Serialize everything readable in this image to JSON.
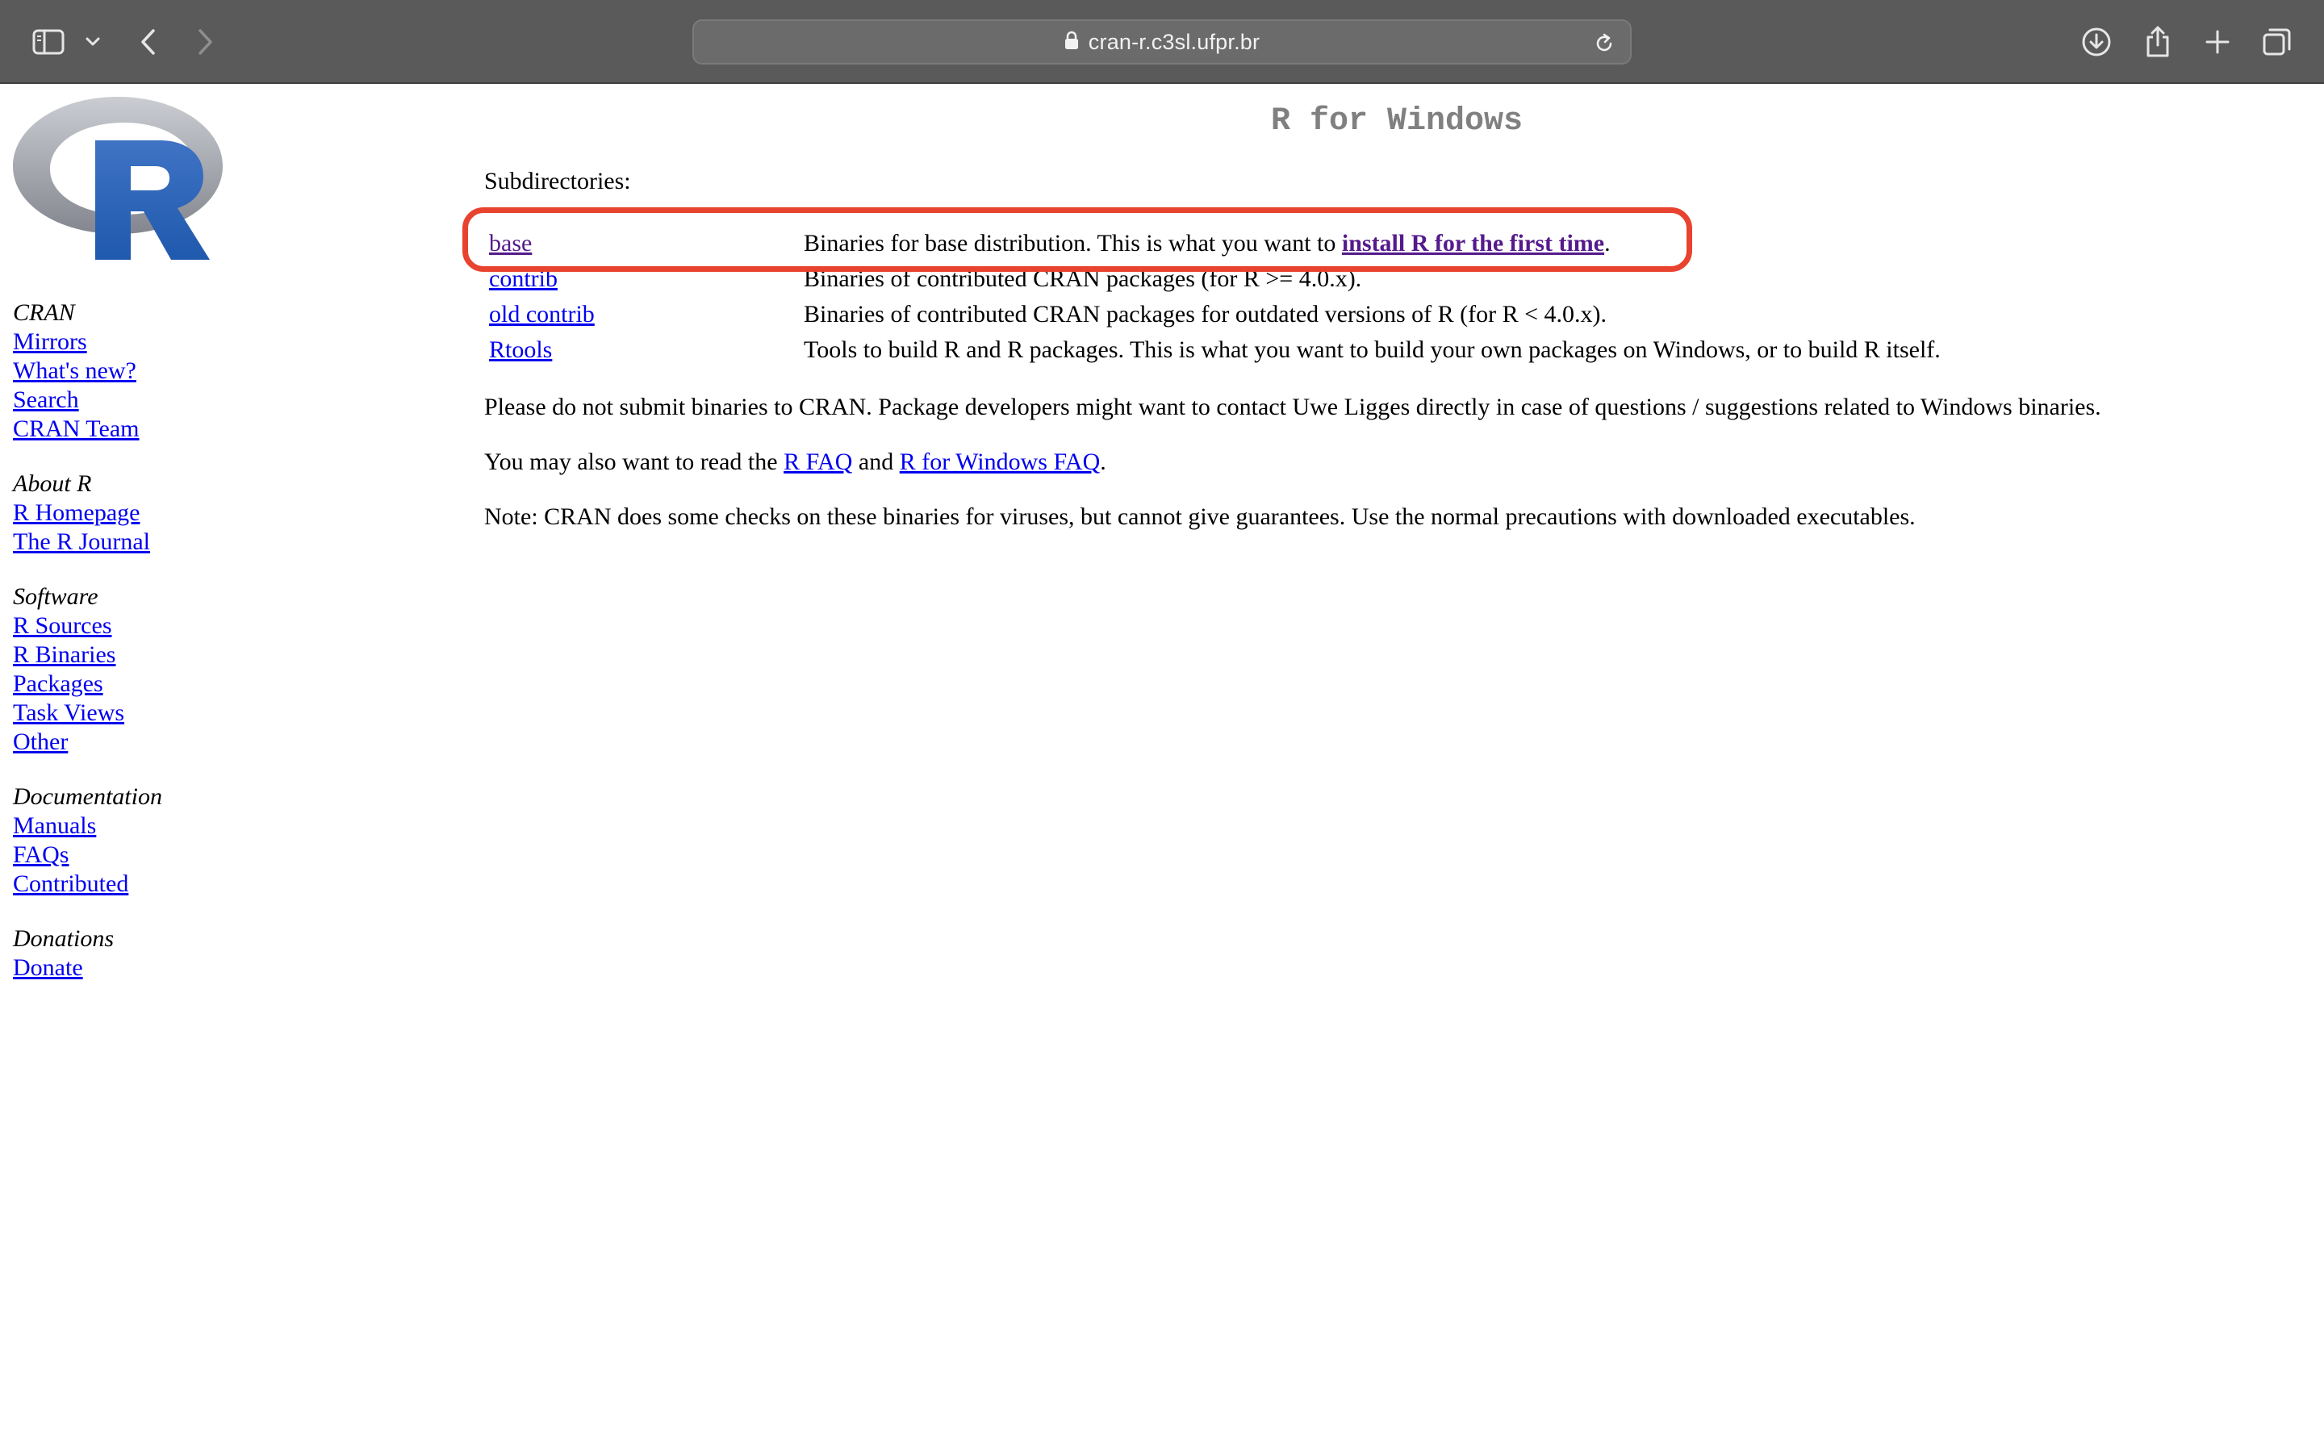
{
  "browser": {
    "url": "cran-r.c3sl.ufpr.br",
    "icons": {
      "sidebar": "sidebar-icon",
      "chevron": "chevron-down-icon",
      "back": "back-icon",
      "forward": "forward-icon",
      "lock": "lock-icon",
      "reload": "reload-icon",
      "download": "download-icon",
      "share": "share-icon",
      "new_tab": "plus-icon",
      "tabs": "tabs-overview-icon"
    }
  },
  "logo": {
    "icon": "r-logo-icon",
    "letter": "R"
  },
  "sidebar": {
    "groups": [
      {
        "heading": "CRAN",
        "links": [
          "Mirrors",
          "What's new?",
          "Search",
          "CRAN Team"
        ]
      },
      {
        "heading": "About R",
        "links": [
          "R Homepage",
          "The R Journal"
        ]
      },
      {
        "heading": "Software",
        "links": [
          "R Sources",
          "R Binaries",
          "Packages",
          "Task Views",
          "Other"
        ]
      },
      {
        "heading": "Documentation",
        "links": [
          "Manuals",
          "FAQs",
          "Contributed"
        ]
      },
      {
        "heading": "Donations",
        "links": [
          "Donate"
        ]
      }
    ]
  },
  "main": {
    "title": "R for Windows",
    "subdir_label": "Subdirectories:",
    "rows": [
      {
        "name": "base",
        "desc": "Binaries for base distribution. This is what you want to ",
        "link": "install R for the first time",
        "tail": "."
      },
      {
        "name": "contrib",
        "desc": "Binaries of contributed CRAN packages (for R >= 4.0.x)."
      },
      {
        "name": "old contrib",
        "desc": "Binaries of contributed CRAN packages for outdated versions of R (for R < 4.0.x)."
      },
      {
        "name": "Rtools",
        "desc": "Tools to build R and R packages. This is what you want to build your own packages on Windows, or to build R itself."
      }
    ],
    "p1": "Please do not submit binaries to CRAN. Package developers might want to contact Uwe Ligges directly in case of questions / suggestions related to Windows binaries.",
    "p2": {
      "before": "You may also want to read the ",
      "link1": "R FAQ",
      "mid": " and ",
      "link2": "R for Windows FAQ",
      "after": "."
    },
    "p3": "Note: CRAN does some checks on these binaries for viruses, but cannot give guarantees. Use the normal precautions with downloaded executables."
  },
  "annotation": {
    "color": "#e8432e"
  }
}
